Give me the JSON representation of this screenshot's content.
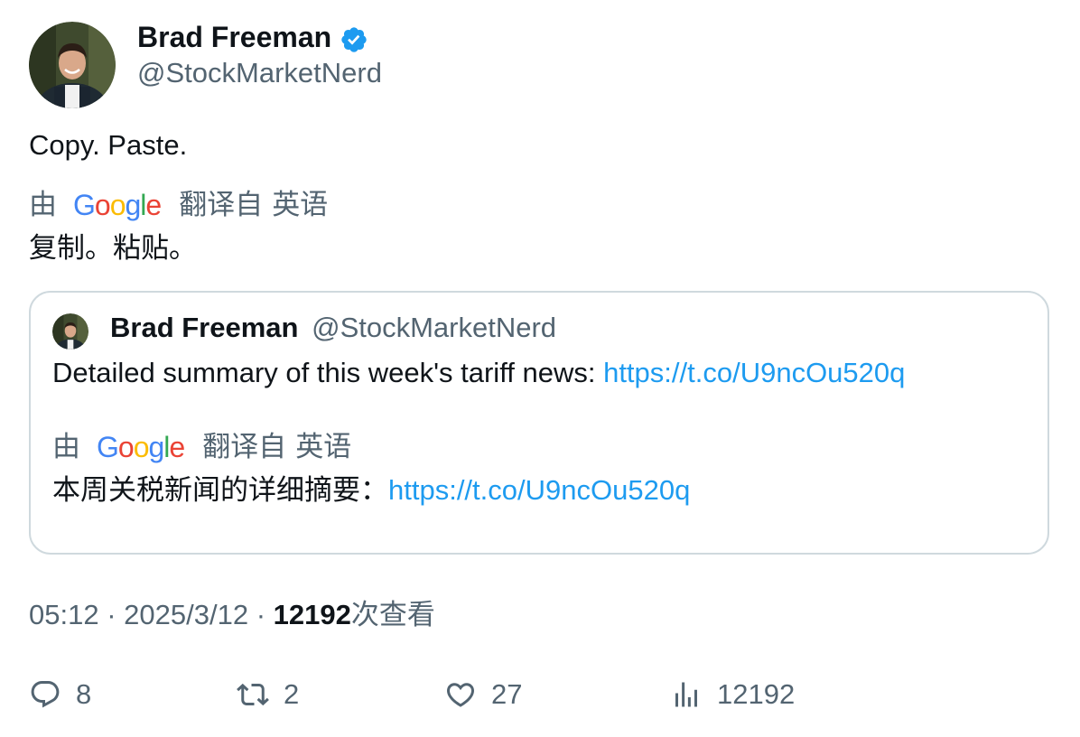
{
  "author": {
    "name": "Brad Freeman",
    "handle": "@StockMarketNerd",
    "verified": true
  },
  "tweet": {
    "text": "Copy. Paste.",
    "translation": {
      "by_label": "由",
      "provider": "Google",
      "from_label": "翻译自",
      "language": "英语",
      "text": "复制。粘贴。"
    }
  },
  "quoted_tweet": {
    "author_name": "Brad Freeman",
    "author_handle": "@StockMarketNerd",
    "text": "Detailed summary of this week's tariff news: ",
    "link": "https://t.co/U9ncOu520q",
    "translation": {
      "by_label": "由",
      "provider": "Google",
      "from_label": "翻译自",
      "language": "英语",
      "text": "本周关税新闻的详细摘要：",
      "link": "https://t.co/U9ncOu520q"
    }
  },
  "meta": {
    "time": "05:12",
    "separator": "·",
    "date": "2025/3/12",
    "views_count": "12192",
    "views_label": "次查看"
  },
  "actions": {
    "replies": "8",
    "retweets": "2",
    "likes": "27",
    "views": "12192"
  },
  "colors": {
    "text_primary": "#0f1419",
    "text_secondary": "#536471",
    "link": "#1d9bf0",
    "verified": "#1d9bf0",
    "border": "#cfd9de",
    "google_blue": "#4285F4",
    "google_red": "#EA4335",
    "google_yellow": "#FBBC05",
    "google_green": "#34A853"
  },
  "icons": {
    "reply": "speech-bubble-icon",
    "retweet": "retweet-arrows-icon",
    "like": "heart-icon",
    "views": "bar-chart-icon",
    "verified": "verified-badge-icon"
  }
}
